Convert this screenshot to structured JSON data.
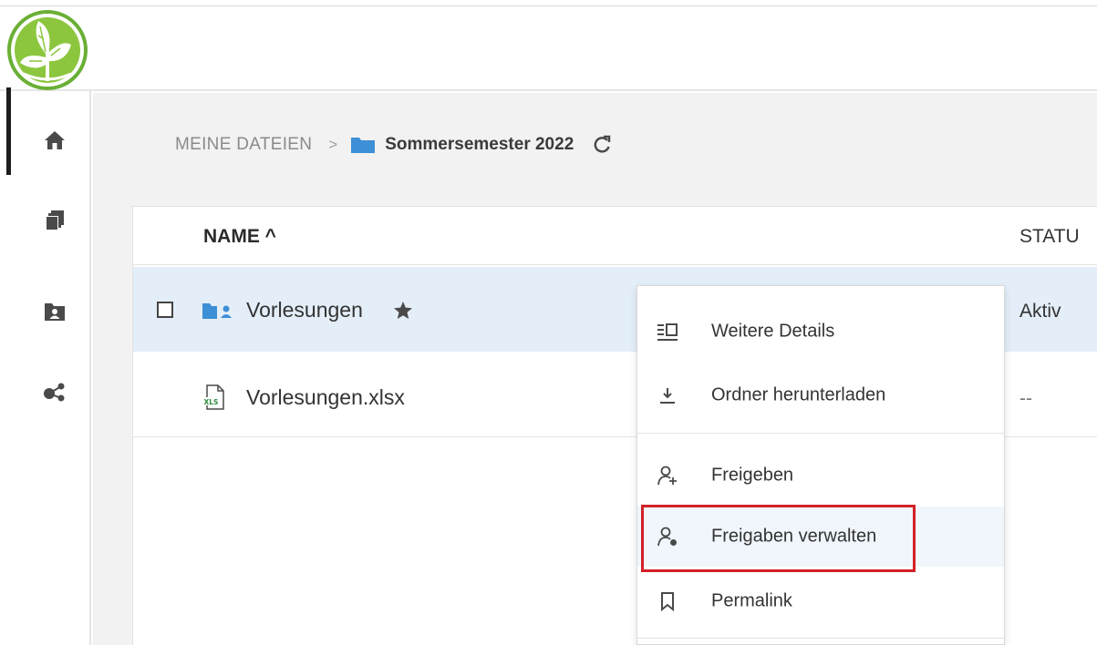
{
  "app": {
    "logo": "beech-leaf-logo",
    "brand_colors": {
      "logo_green": "#8cc63f",
      "logo_dark_green": "#4a9a2c"
    }
  },
  "sidebar": {
    "items": [
      {
        "name": "home",
        "icon": "home-icon",
        "active": false
      },
      {
        "name": "files",
        "icon": "files-icon",
        "active": true
      },
      {
        "name": "shared-folders",
        "icon": "folder-user-icon",
        "active": false
      },
      {
        "name": "shared",
        "icon": "share-icon",
        "active": false
      }
    ]
  },
  "breadcrumb": {
    "root": "MEINE DATEIEN",
    "separator": ">",
    "current": "Sommersemester 2022",
    "folder_icon": "folder-icon",
    "refresh_icon": "refresh-icon"
  },
  "table": {
    "columns": {
      "name": "NAME ^",
      "status": "STATU"
    },
    "rows": [
      {
        "name": "Vorlesungen",
        "type": "shared-folder",
        "icon": "shared-folder-icon",
        "favorite_icon": "star-icon",
        "status": "Aktiv",
        "selected": true
      },
      {
        "name": "Vorlesungen.xlsx",
        "type": "xlsx",
        "icon": "xls-file-icon",
        "status": "--",
        "selected": false
      }
    ]
  },
  "context_menu": {
    "items": [
      {
        "label": "Weitere Details",
        "icon": "details-icon"
      },
      {
        "label": "Ordner herunterladen",
        "icon": "download-icon"
      },
      {
        "label": "Freigeben",
        "icon": "share-user-icon"
      },
      {
        "label": "Freigaben verwalten",
        "icon": "manage-share-icon",
        "highlighted": true
      },
      {
        "label": "Permalink",
        "icon": "bookmark-icon"
      }
    ]
  },
  "colors": {
    "selected_row": "#e3eef8",
    "folder_blue": "#3d8fd6",
    "highlight_red": "#d42027",
    "content_bg": "#f2f2f2"
  }
}
